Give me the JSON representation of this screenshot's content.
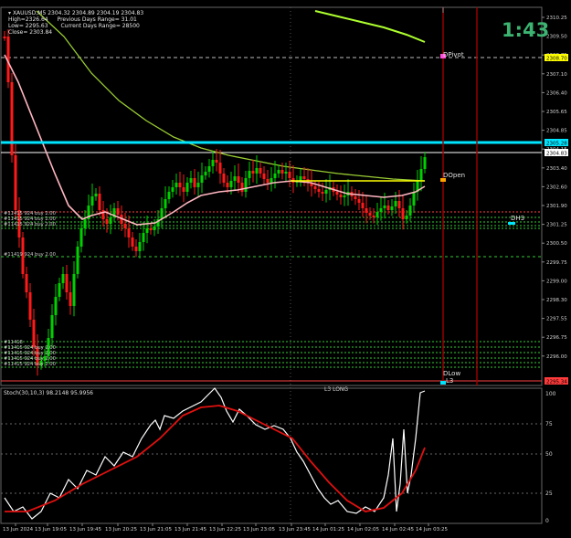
{
  "header": {
    "symbol": "XAUUSD,M5",
    "ohlc": "2304.32 2304.89 2304.19 2304.83",
    "high_line": "High=2326.64",
    "prev_range": "Previous Days Range= 31.01",
    "low_line": "Low= 2295.63",
    "current_range": "Current Days Range= 28500",
    "close_line": "Close= 2303.84"
  },
  "timer": "1:43",
  "price_axis": [
    "2310.25",
    "2309.50",
    "2308.75",
    "2307.10",
    "2306.40",
    "2305.65",
    "2304.85",
    "2304.15",
    "2303.40",
    "2302.60",
    "2301.90",
    "2301.25",
    "2300.50",
    "2299.75",
    "2299.00",
    "2298.30",
    "2297.55",
    "2296.75",
    "2296.00"
  ],
  "price_badges": [
    {
      "text": "2308.70",
      "color": "#ffff00"
    },
    {
      "text": "2305.28",
      "color": "#00e5ff"
    },
    {
      "text": "2304.83",
      "color": "#ffffff"
    },
    {
      "text": "2295.34",
      "color": "#ff3b3b"
    }
  ],
  "pivot_labels": [
    "DPivot",
    "DOpen",
    "DLow",
    "DH3",
    "L3"
  ],
  "order_labels": [
    "#11415 924 buy 2.00",
    "#11419 924 buy 2.00"
  ],
  "order_label_partial": "#11418",
  "level_label": "L3 LONG",
  "time_axis": [
    "13 Jun 2024",
    "13 Jun 19:05",
    "13 Jun 19:45",
    "13 Jun 20:25",
    "13 Jun 21:05",
    "13 Jun 21:45",
    "13 Jun 22:25",
    "13 Jun 23:05",
    "13 Jun 23:45",
    "14 Jun 01:25",
    "14 Jun 02:05",
    "14 Jun 02:45",
    "14 Jun 03:25"
  ],
  "stoch": {
    "title": "Stoch(30,10,3) 98.2148 95.9956",
    "levels": [
      "100",
      "75",
      "50",
      "25",
      "0"
    ]
  },
  "colors": {
    "up": "#00d000",
    "down": "#ff1a1a",
    "ma_fast": "#ffb6c1",
    "ma_slow": "#9acd32",
    "cyan": "#00e5ff",
    "yellow": "#ffff00",
    "timer": "#3cb371"
  }
}
